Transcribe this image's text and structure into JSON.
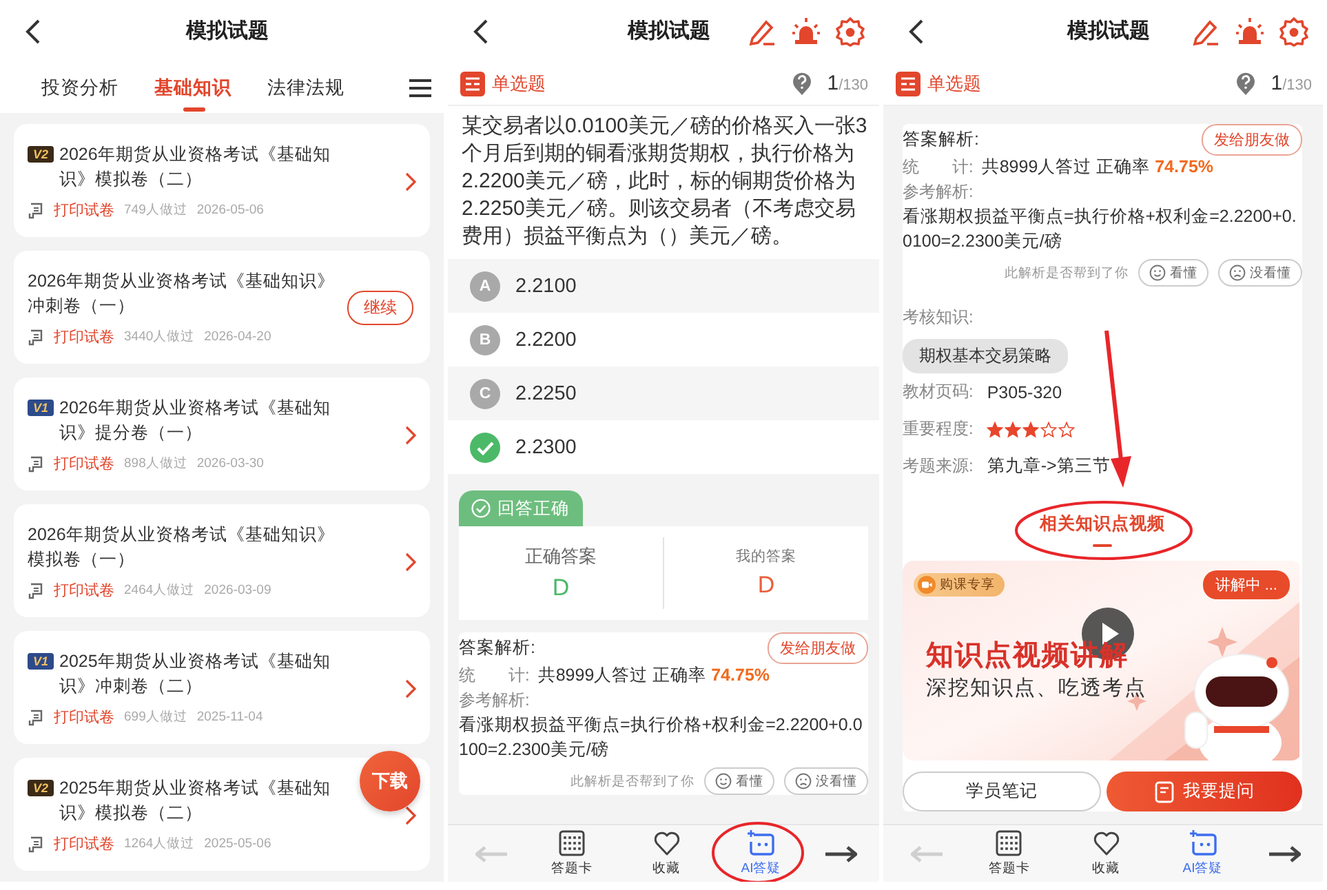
{
  "list_screen": {
    "title": "模拟试题",
    "tabs": [
      {
        "label": "投资分析",
        "selected": false
      },
      {
        "label": "基础知识",
        "selected": true
      },
      {
        "label": "法律法规",
        "selected": false
      }
    ],
    "papers": [
      {
        "badge": {
          "text": "V2",
          "color": "#3b2a17"
        },
        "title": "2026年期货从业资格考试《基础知识》模拟卷（二）",
        "print": "打印试卷",
        "count": "749人做过",
        "date": "2026-05-06",
        "kind": "arrow"
      },
      {
        "title": "2026年期货从业资格考试《基础知识》冲刺卷（一）",
        "print": "打印试卷",
        "count": "3440人做过",
        "date": "2026-04-20",
        "kind": "continue",
        "action": "继续"
      },
      {
        "badge": {
          "text": "V1",
          "color": "#2d4a8a"
        },
        "title": "2026年期货从业资格考试《基础知识》提分卷（一）",
        "print": "打印试卷",
        "count": "898人做过",
        "date": "2026-03-30",
        "kind": "arrow"
      },
      {
        "title": "2026年期货从业资格考试《基础知识》模拟卷（一）",
        "print": "打印试卷",
        "count": "2464人做过",
        "date": "2026-03-09",
        "kind": "arrow"
      },
      {
        "badge": {
          "text": "V1",
          "color": "#2d4a8a"
        },
        "title": "2025年期货从业资格考试《基础知识》冲刺卷（二）",
        "print": "打印试卷",
        "count": "699人做过",
        "date": "2025-11-04",
        "kind": "arrow"
      },
      {
        "badge": {
          "text": "V2",
          "color": "#3b2a17"
        },
        "title": "2025年期货从业资格考试《基础知识》模拟卷（二）",
        "print": "打印试卷",
        "count": "1264人做过",
        "date": "2025-05-06",
        "kind": "arrow"
      }
    ],
    "fab": "下载"
  },
  "question_screen": {
    "title": "模拟试题",
    "type": "单选题",
    "progress": {
      "current": "1",
      "total": "/130"
    },
    "question": "某交易者以0.0100美元／磅的价格买入一张3个月后到期的铜看涨期货期权，执行价格为2.2200美元／磅，此时，标的铜期货价格为2.2250美元／磅。则该交易者（不考虑交易费用）损益平衡点为（）美元／磅。",
    "options": [
      {
        "letter": "A",
        "text": "2.2100",
        "correct": false
      },
      {
        "letter": "B",
        "text": "2.2200",
        "correct": false
      },
      {
        "letter": "C",
        "text": "2.2250",
        "correct": false
      },
      {
        "text": "2.2300",
        "correct": true
      }
    ],
    "result": {
      "label": "回答正确",
      "correct_label": "正确答案",
      "correct": "D",
      "mine_label": "我的答案",
      "mine": "D"
    },
    "analysis": {
      "heading": "答案解析:",
      "share": "发给朋友做",
      "stats_label": "统　　计:",
      "stats": "共8999人答过 正确率",
      "rate": "74.75%",
      "ref_label": "参考解析:",
      "explanation": "看涨期权损益平衡点=执行价格+权利金=2.2200+0.0100=2.2300美元/磅",
      "helpful": "此解析是否帮到了你",
      "understood": "看懂",
      "not_understood": "没看懂"
    },
    "bottom_bar": {
      "prev_disabled": true,
      "items": [
        {
          "label": "答题卡",
          "kind": "card",
          "selected": false
        },
        {
          "label": "收藏",
          "kind": "favorite",
          "selected": false
        },
        {
          "label": "AI答疑",
          "kind": "ai",
          "selected": true
        }
      ]
    }
  },
  "analysis_screen": {
    "title": "模拟试题",
    "type": "单选题",
    "progress": {
      "current": "1",
      "total": "/130"
    },
    "analysis": {
      "heading": "答案解析:",
      "share": "发给朋友做",
      "stats_label": "统　　计:",
      "stats": "共8999人答过 正确率",
      "rate": "74.75%",
      "ref_label": "参考解析:",
      "explanation": "看涨期权损益平衡点=执行价格+权利金=2.2200+0.0100=2.2300美元/磅",
      "helpful": "此解析是否帮到了你",
      "understood": "看懂",
      "not_understood": "没看懂"
    },
    "knowledge": {
      "label": "考核知识:",
      "tags": [
        "期权基本交易策略"
      ]
    },
    "details": [
      {
        "label": "教材页码:",
        "kind": "text",
        "value": "P305-320"
      },
      {
        "label": "重要程度:",
        "kind": "stars",
        "stars": 3
      },
      {
        "label": "考题来源:",
        "kind": "text",
        "value": "第九章->第三节"
      }
    ],
    "video_tab": "相关知识点视频",
    "video": {
      "kind": "picture",
      "badge": "购课专享",
      "status": "讲解中 ...",
      "headline": "知识点视频讲解",
      "subtitle": "深挖知识点、吃透考点"
    },
    "buttons": [
      {
        "label": "学员笔记",
        "kind": "outline"
      },
      {
        "label": "我要提问",
        "kind": "primary"
      }
    ],
    "bottom_bar": {
      "prev_disabled": true,
      "items": [
        {
          "label": "答题卡",
          "kind": "card",
          "selected": false
        },
        {
          "label": "收藏",
          "kind": "favorite",
          "selected": false
        },
        {
          "label": "AI答疑",
          "kind": "ai",
          "selected": true
        }
      ]
    }
  }
}
